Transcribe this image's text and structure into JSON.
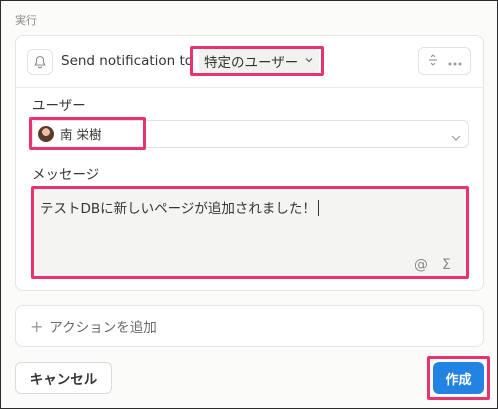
{
  "section": {
    "label": "実行"
  },
  "action": {
    "header_text": "Send notification to",
    "user_type_value": "特定のユーザー",
    "icons": {
      "bell": "bell-icon",
      "chevron": "chevron-down-icon",
      "split": "split-icon",
      "more": "more-icon"
    }
  },
  "user_field": {
    "label": "ユーザー",
    "selected_user": "南 栄樹"
  },
  "message_field": {
    "label": "メッセージ",
    "value": "テストDBに新しいページが追加されました！",
    "mention_symbol": "@",
    "formula_symbol": "Σ"
  },
  "add_action": {
    "plus": "+",
    "label": "アクションを追加"
  },
  "footer": {
    "cancel_label": "キャンセル",
    "create_label": "作成"
  },
  "colors": {
    "highlight": "#e8336e",
    "primary": "#2383e2"
  }
}
